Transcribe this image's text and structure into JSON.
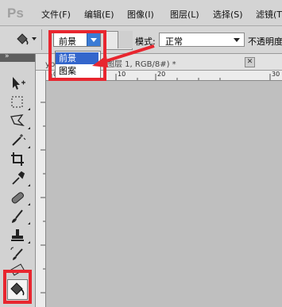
{
  "app": {
    "logo_text": "Ps"
  },
  "menubar": {
    "items": [
      {
        "label": "文件(F)"
      },
      {
        "label": "编辑(E)"
      },
      {
        "label": "图像(I)"
      },
      {
        "label": "图层(L)"
      },
      {
        "label": "选择(S)"
      },
      {
        "label": "滤镜(T"
      }
    ]
  },
  "options": {
    "fill_source": {
      "selected": "前景",
      "options": [
        "前景",
        "图案"
      ]
    },
    "mode_label": "模式:",
    "mode_value": "正常",
    "opacity_label": "不透明度"
  },
  "document": {
    "tab_title": "yb.... @ 100% (图层 1, RGB/8#) *",
    "close_glyph": "✕"
  },
  "ruler": {
    "top_labels": [
      "0",
      "10",
      "20",
      "30"
    ]
  },
  "toolbox": {
    "collapse_glyph": "»",
    "tools": [
      {
        "name": "move"
      },
      {
        "name": "marquee"
      },
      {
        "name": "lasso"
      },
      {
        "name": "magic-wand"
      },
      {
        "name": "crop"
      },
      {
        "name": "eyedropper"
      },
      {
        "name": "healing"
      },
      {
        "name": "brush"
      },
      {
        "name": "clone-stamp"
      },
      {
        "name": "history-brush"
      },
      {
        "name": "eraser"
      },
      {
        "name": "paint-bucket",
        "active": true
      }
    ]
  },
  "colors": {
    "highlight": "#e8262f",
    "selection": "#3366cc"
  }
}
